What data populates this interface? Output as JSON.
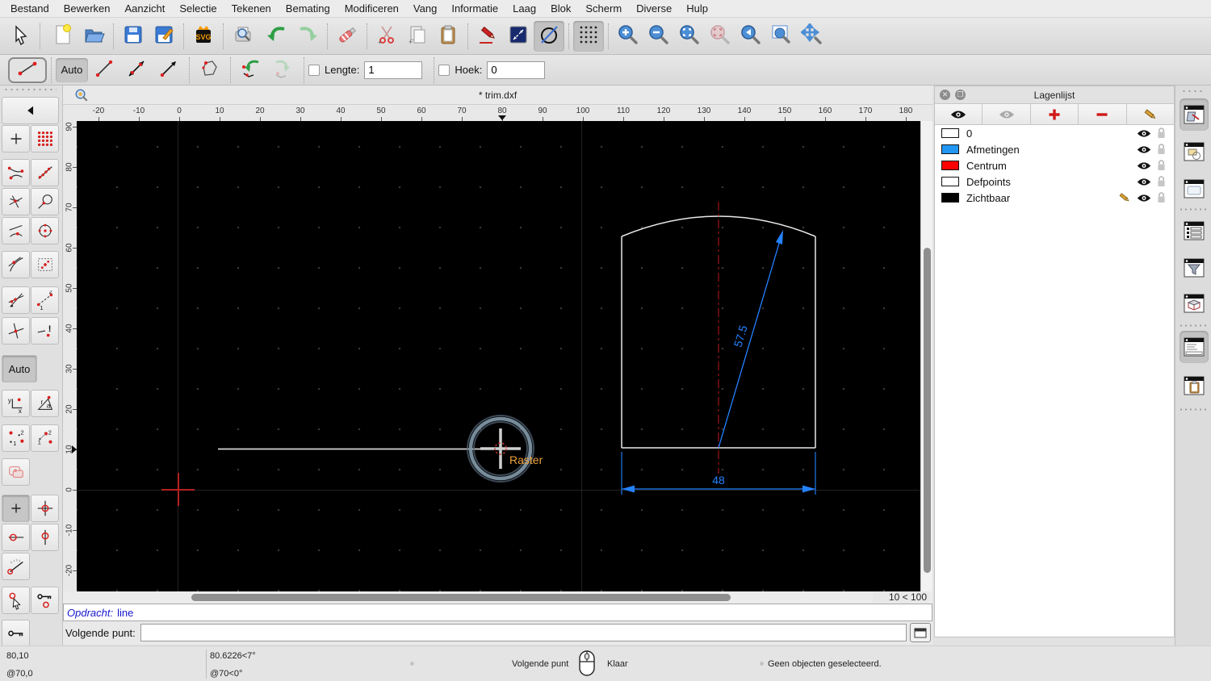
{
  "menu": {
    "items": [
      "Bestand",
      "Bewerken",
      "Aanzicht",
      "Selectie",
      "Tekenen",
      "Bemating",
      "Modificeren",
      "Vang",
      "Informatie",
      "Laag",
      "Blok",
      "Scherm",
      "Diverse",
      "Hulp"
    ]
  },
  "toolbar": {
    "icons": [
      "pointer",
      "new-document",
      "open-file",
      "save",
      "save-as",
      "svg-export",
      "print-preview",
      "undo",
      "redo",
      "delete",
      "cut",
      "copy",
      "paste",
      "draw-pencil",
      "dimension",
      "circle-line",
      "grid-toggle",
      "zoom-in",
      "zoom-out",
      "zoom-auto",
      "zoom-selection",
      "zoom-previous",
      "zoom-window",
      "pan"
    ]
  },
  "options_bar": {
    "auto_label": "Auto",
    "lengte_label": "Lengte:",
    "lengte_value": "1",
    "hoek_label": "Hoek:",
    "hoek_value": "0"
  },
  "snap_toolbar": {
    "auto_label": "Auto"
  },
  "document": {
    "title": "* trim.dxf"
  },
  "rulers": {
    "h": [
      "-20",
      "-10",
      "0",
      "10",
      "20",
      "30",
      "40",
      "50",
      "60",
      "70",
      "80",
      "90",
      "100",
      "110",
      "120",
      "130",
      "140",
      "150",
      "160",
      "170",
      "180"
    ],
    "v": [
      "90",
      "80",
      "70",
      "60",
      "50",
      "40",
      "30",
      "20",
      "10",
      "0",
      "-10",
      "-20"
    ],
    "h_marker": "80",
    "v_marker": "10"
  },
  "canvas": {
    "raster_label": "Raster",
    "grid_status": "10 < 100",
    "dim_width": "48",
    "dim_diag": "57.5",
    "colors": {
      "dimension": "#2482ff",
      "centerline": "#a01414",
      "raster": "#f0a23c",
      "shape": "#e8e8e8",
      "snap_ring": "#7d93a3",
      "origin_cross": "#b42020"
    }
  },
  "layers_panel": {
    "title": "Lagenlijst",
    "items": [
      {
        "name": "0",
        "color": "#ffffff"
      },
      {
        "name": "Afmetingen",
        "color": "#2196f3"
      },
      {
        "name": "Centrum",
        "color": "#ff0000"
      },
      {
        "name": "Defpoints",
        "color": "#ffffff"
      },
      {
        "name": "Zichtbaar",
        "color": "#000000",
        "active": true
      }
    ]
  },
  "command": {
    "opdracht_label": "Opdracht:",
    "opdracht_value": "line",
    "prompt_label": "Volgende punt:",
    "input_value": ""
  },
  "statusbar": {
    "coord_abs": "80,10",
    "coord_rel": "@70,0",
    "polar_abs": "80.6226<7°",
    "polar_rel": "@70<0°",
    "hint_left": "Volgende punt",
    "hint_right": "Klaar",
    "selection": "Geen objecten geselecteerd."
  }
}
